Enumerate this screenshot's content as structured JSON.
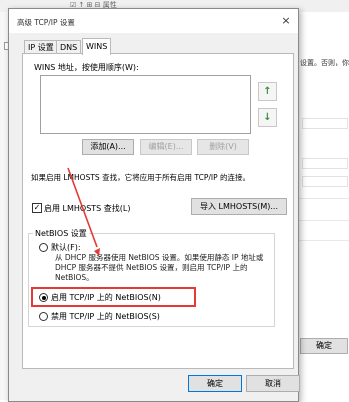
{
  "dialog": {
    "title": "高级 TCP/IP 设置",
    "close_icon": "×",
    "tabs": [
      "IP 设置",
      "DNS",
      "WINS"
    ],
    "active_tab": "WINS"
  },
  "wins": {
    "address_label": "WINS 地址，按使用顺序(W):",
    "move_up_icon": "↑",
    "move_down_icon": "↓",
    "add_button": "添加(A)...",
    "edit_button": "编辑(E)...",
    "delete_button": "删除(V)",
    "lmhosts_info": "如果启用 LMHOSTS 查找，它将应用于所有启用 TCP/IP 的连接。",
    "lmhosts_checkbox_label": "启用 LMHOSTS 查找(L)",
    "lmhosts_checked": true,
    "checkmark": "✓",
    "import_button": "导入 LMHOSTS(M)..."
  },
  "netbios": {
    "group_title": "NetBIOS 设置",
    "default_option": "默认(F):",
    "default_desc": "从 DHCP 服务器使用 NetBIOS 设置。如果使用静态 IP 地址或 DHCP 服务器不提供 NetBIOS 设置，则启用 TCP/IP 上的 NetBIOS。",
    "enable_option": "启用 TCP/IP 上的 NetBIOS(N)",
    "disable_option": "禁用 TCP/IP 上的 NetBIOS(S)",
    "selected": "enable"
  },
  "footer": {
    "ok_button": "确定",
    "cancel_button": "取消"
  },
  "background": {
    "text_snippet": "设置。否则，你",
    "ok_button": "确定",
    "top_text": "☑ ↑ ⊞ ⊟ 属性"
  },
  "colors": {
    "highlight": "#e53935",
    "arrow": "#e53935",
    "accent": "#0078d7"
  }
}
